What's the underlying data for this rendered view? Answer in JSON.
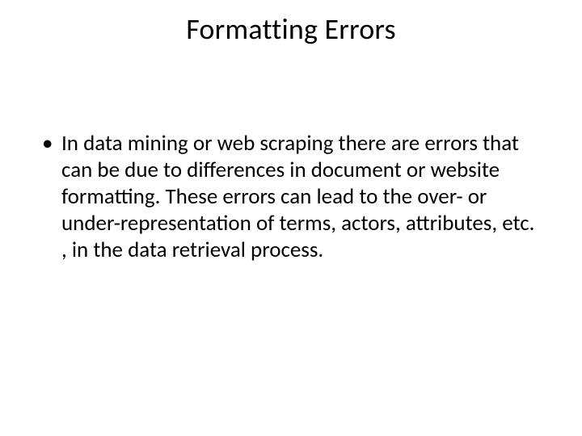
{
  "slide": {
    "title": "Formatting Errors",
    "bullets": [
      "In data mining or web scraping there are errors that can be due to differences in document or website formatting. These errors can lead to the over- or under-representation of terms, actors, attributes, etc. , in the data retrieval process."
    ]
  }
}
